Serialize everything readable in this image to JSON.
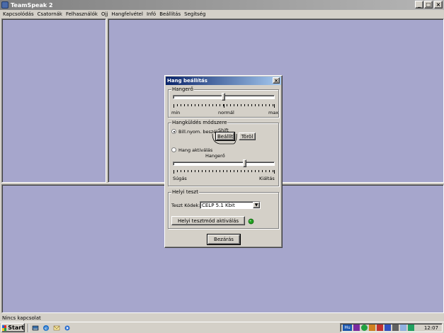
{
  "window": {
    "title": "TeamSpeak 2",
    "controls": {
      "minimize": "_",
      "maximize": "□",
      "close": "×"
    }
  },
  "menu": [
    "Kapcsolódás",
    "Csatornák",
    "Felhasználók",
    "Ojj",
    "Hangfelvétel",
    "Infó",
    "Beállítás",
    "Segítség"
  ],
  "status": {
    "text": "Nincs kapcsolat"
  },
  "taskbar": {
    "start_label": "Start",
    "clock": "12:07"
  },
  "colors": {
    "pane_bg": "#a6a6cc",
    "dialog_title": "#0a246a",
    "led_green": "#22a020"
  },
  "dialog": {
    "title": "Hang beállítás",
    "close": "×",
    "volume_group": {
      "label": "Hangerő",
      "slider_value_fraction": 0.5,
      "min": "min",
      "mid": "normál",
      "max": "max"
    },
    "method_group": {
      "label": "Hangküldés módszere",
      "ptt_label": "Bill.nyom. beszél",
      "ptt_key": "Shift",
      "set_button": "Beállít",
      "clear_button": "Töröl",
      "va_label": "Hang aktiválás",
      "va_volume_label": "Hangerő",
      "va_slider_value_fraction": 0.7,
      "va_min": "Súgás",
      "va_max": "Kiáltás",
      "selected": "ptt"
    },
    "local_test_group": {
      "label": "Helyi teszt",
      "codec_label": "Teszt Kódek:",
      "codec_value": "CELP 5.1 Kbit",
      "activate_button": "Helyi tesztmód aktiválás",
      "led_state": "green"
    },
    "close_button": "Bezárás"
  }
}
